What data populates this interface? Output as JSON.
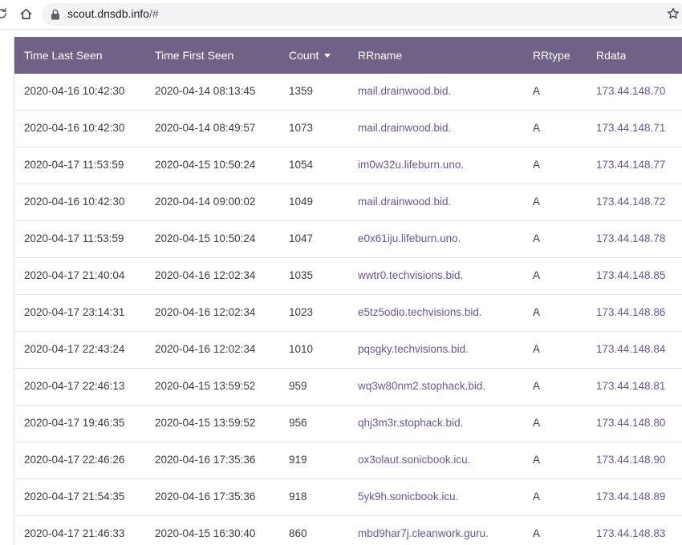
{
  "browser": {
    "url_domain": "scout.dnsdb.info",
    "url_path": "/#"
  },
  "table": {
    "headers": [
      "Time Last Seen",
      "Time First Seen",
      "Count",
      "RRname",
      "RRtype",
      "Rdata"
    ],
    "sorted_column": "Count",
    "sort_direction": "descending",
    "rows": [
      [
        "2020-04-16 10:42:30",
        "2020-04-14 08:13:45",
        "1359",
        "mail.drainwood.bid.",
        "A",
        "173.44.148.70"
      ],
      [
        "2020-04-16 10:42:30",
        "2020-04-14 08:49:57",
        "1073",
        "mail.drainwood.bid.",
        "A",
        "173.44.148.71"
      ],
      [
        "2020-04-17 11:53:59",
        "2020-04-15 10:50:24",
        "1054",
        "im0w32u.lifeburn.uno.",
        "A",
        "173.44.148.77"
      ],
      [
        "2020-04-16 10:42:30",
        "2020-04-14 09:00:02",
        "1049",
        "mail.drainwood.bid.",
        "A",
        "173.44.148.72"
      ],
      [
        "2020-04-17 11:53:59",
        "2020-04-15 10:50:24",
        "1047",
        "e0x61iju.lifeburn.uno.",
        "A",
        "173.44.148.78"
      ],
      [
        "2020-04-17 21:40:04",
        "2020-04-16 12:02:34",
        "1035",
        "wwtr0.techvisions.bid.",
        "A",
        "173.44.148.85"
      ],
      [
        "2020-04-17 23:14:31",
        "2020-04-16 12:02:34",
        "1023",
        "e5tz5odio.techvisions.bid.",
        "A",
        "173.44.148.86"
      ],
      [
        "2020-04-17 22:43:24",
        "2020-04-16 12:02:34",
        "1010",
        "pqsgky.techvisions.bid.",
        "A",
        "173.44.148.84"
      ],
      [
        "2020-04-17 22:46:13",
        "2020-04-15 13:59:52",
        "959",
        "wq3w80nm2.stophack.bid.",
        "A",
        "173.44.148.81"
      ],
      [
        "2020-04-17 19:46:35",
        "2020-04-15 13:59:52",
        "956",
        "qhj3m3r.stophack.bid.",
        "A",
        "173.44.148.80"
      ],
      [
        "2020-04-17 22:46:26",
        "2020-04-16 17:35:36",
        "919",
        "ox3olaut.sonicbook.icu.",
        "A",
        "173.44.148.90"
      ],
      [
        "2020-04-17 21:54:35",
        "2020-04-16 17:35:36",
        "918",
        "5yk9h.sonicbook.icu.",
        "A",
        "173.44.148.89"
      ],
      [
        "2020-04-17 21:46:33",
        "2020-04-15 16:30:40",
        "860",
        "mbd9har7j.cleanwork.guru.",
        "A",
        "173.44.148.83"
      ]
    ]
  },
  "colors": {
    "header_bg": "#6f6286",
    "link": "#6b5691",
    "text": "#3b3b3b"
  }
}
